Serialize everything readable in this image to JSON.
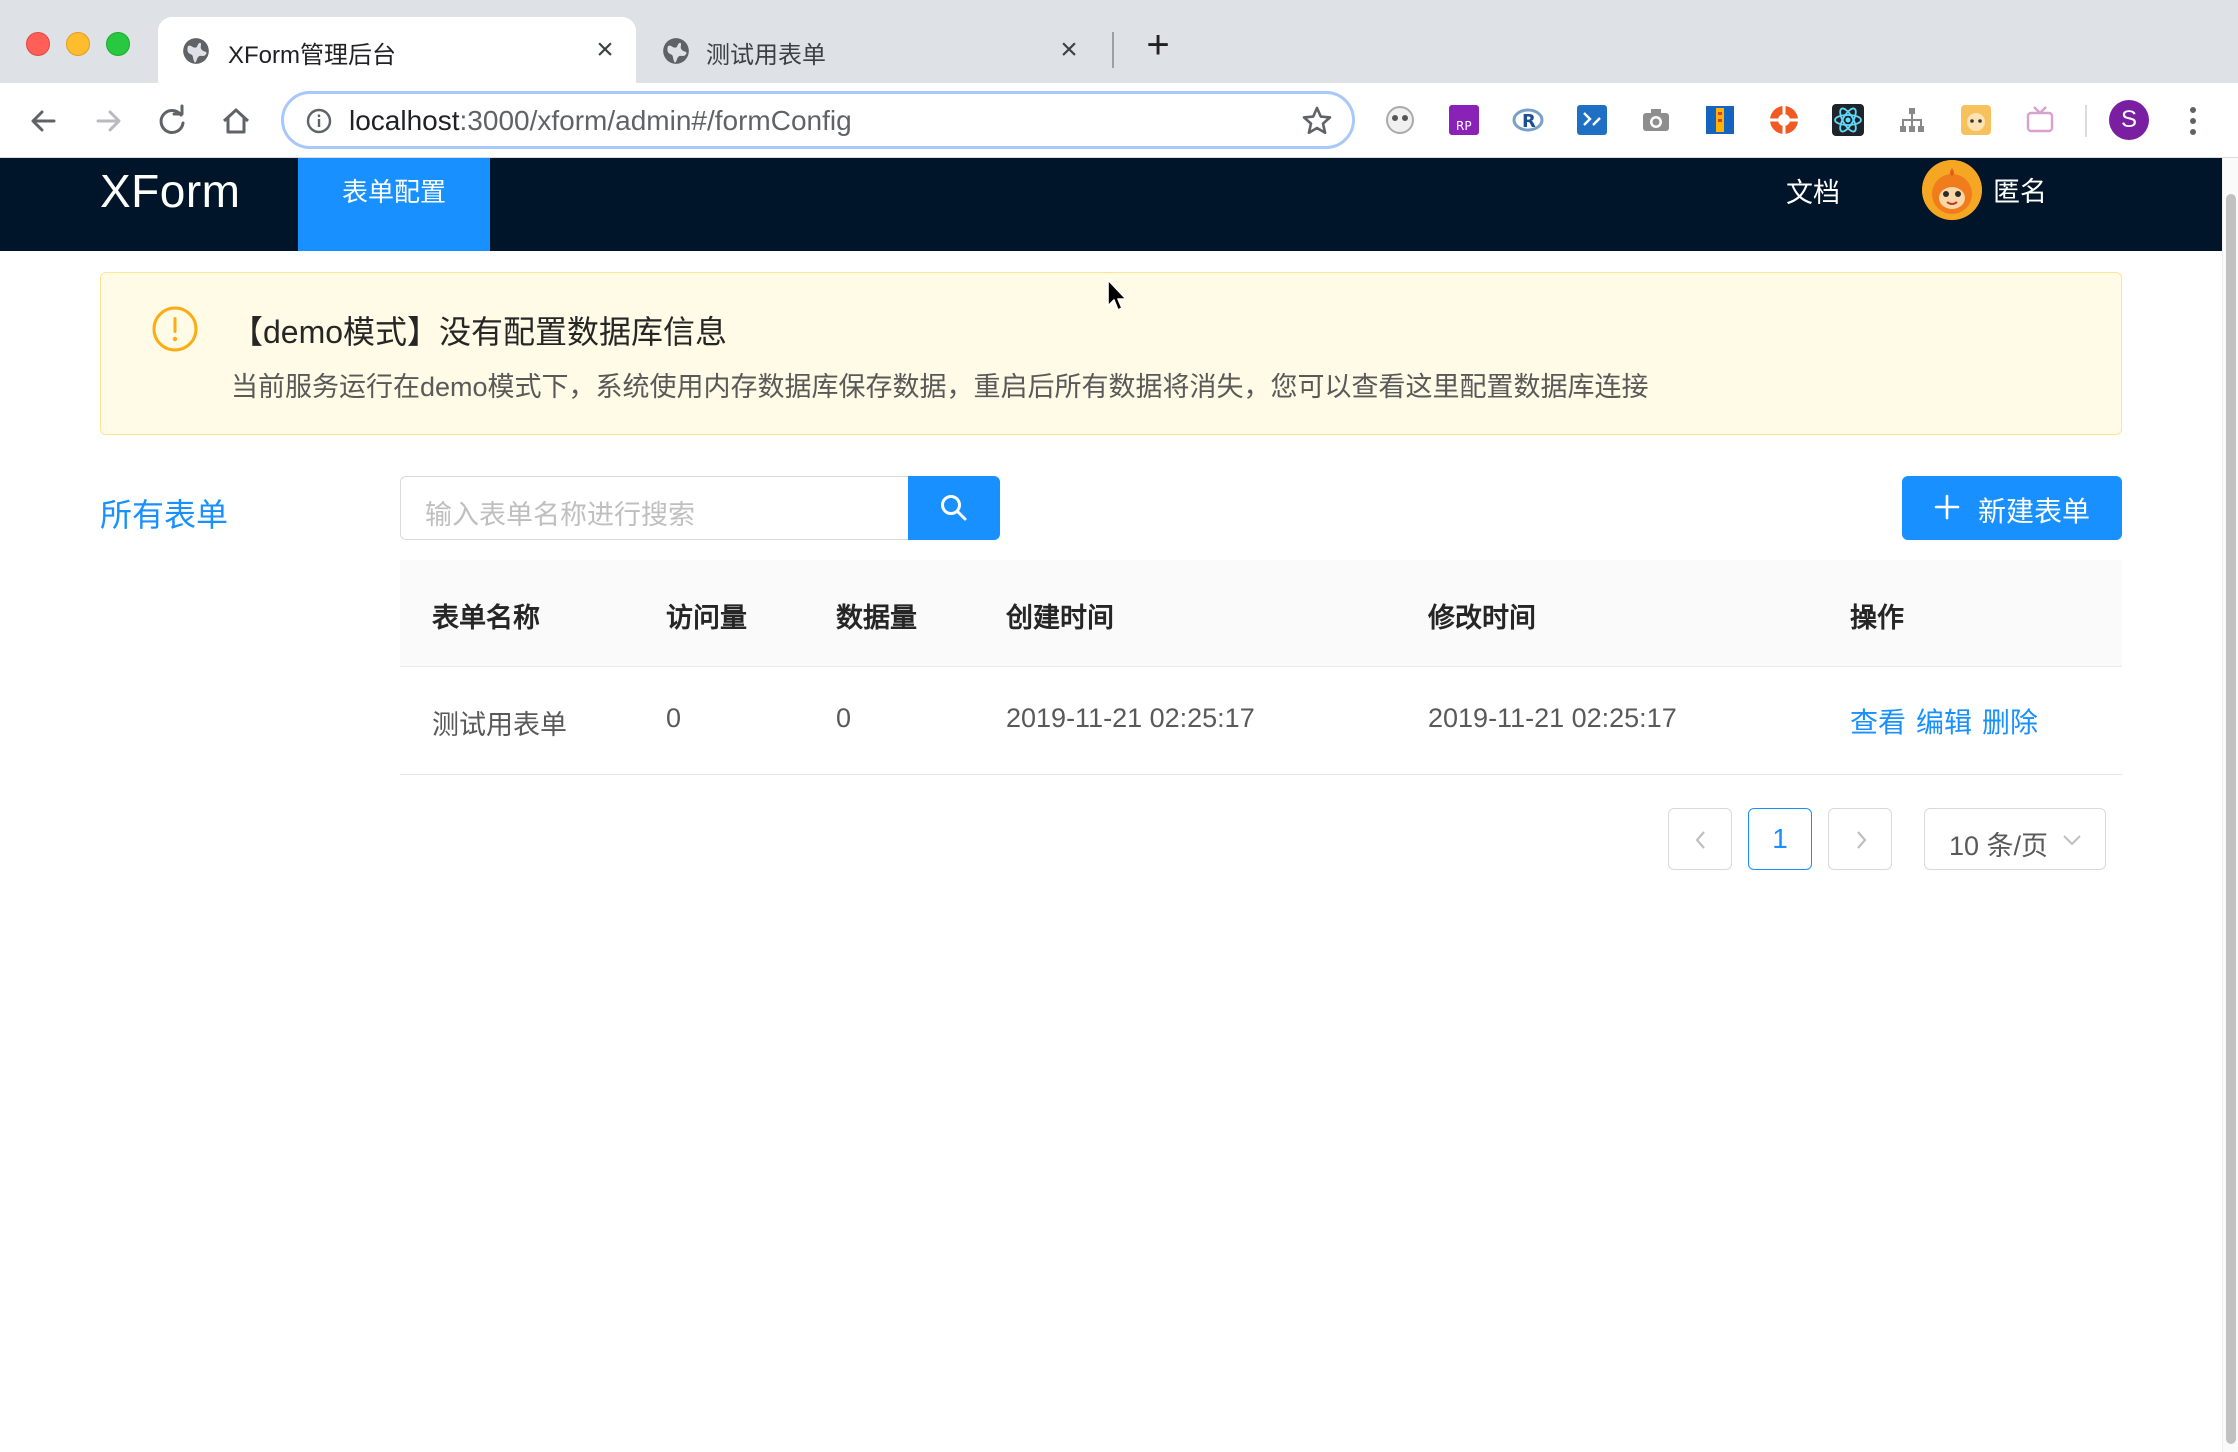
{
  "browser": {
    "tabs": [
      {
        "title": "XForm管理后台",
        "active": true
      },
      {
        "title": "测试用表单",
        "active": false
      }
    ],
    "close_glyph": "×",
    "new_tab_glyph": "+",
    "url_host": "localhost",
    "url_rest": ":3000/xform/admin#/formConfig",
    "profile_initial": "S",
    "extensions": [
      "panda-icon",
      "axure-rp-icon",
      "r-icon",
      "vscode-icon",
      "camera-icon",
      "ruler-icon",
      "lifebuoy-icon",
      "react-icon",
      "sitemap-icon",
      "avatar-icon",
      "tv-icon"
    ]
  },
  "header": {
    "logo": "XForm",
    "nav_active": "表单配置",
    "doc_link": "文档",
    "username": "匿名"
  },
  "alert": {
    "title": "【demo模式】没有配置数据库信息",
    "description": "当前服务运行在demo模式下，系统使用内存数据库保存数据，重启后所有数据将消失，您可以查看这里配置数据库连接",
    "color": "#faad14"
  },
  "sidebar": {
    "title": "所有表单"
  },
  "search": {
    "placeholder": "输入表单名称进行搜索"
  },
  "new_button": {
    "label": "新建表单"
  },
  "table": {
    "columns": [
      "表单名称",
      "访问量",
      "数据量",
      "创建时间",
      "修改时间",
      "操作"
    ],
    "rows": [
      {
        "name": "测试用表单",
        "visits": "0",
        "records": "0",
        "created": "2019-11-21 02:25:17",
        "modified": "2019-11-21 02:25:17",
        "actions": [
          "查看",
          "编辑",
          "删除"
        ]
      }
    ]
  },
  "pagination": {
    "current_page": "1",
    "page_size": "10 条/页"
  },
  "colors": {
    "primary": "#1890ff",
    "header_bg": "#001529",
    "alert_bg": "#fffbe6"
  }
}
